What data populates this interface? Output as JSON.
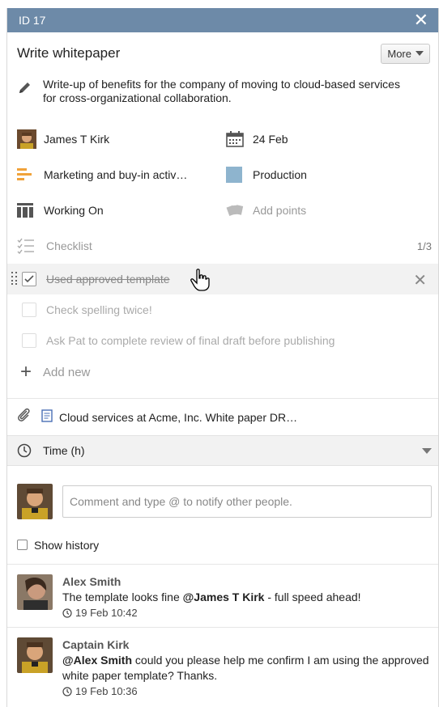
{
  "header": {
    "id_label": "ID 17",
    "close_label": "✕"
  },
  "card": {
    "title": "Write whitepaper",
    "more_label": "More"
  },
  "description": "Write-up of benefits for the company of moving to cloud-based services for cross-organizational collaboration.",
  "properties": {
    "assignee": "James T Kirk",
    "due_date": "24 Feb",
    "lane": "Marketing and buy-in activ…",
    "board": "Production",
    "status": "Working On",
    "points_placeholder": "Add points",
    "colors": {
      "lane_orange": "#f0a23a",
      "board_blue": "#8eb4ce"
    }
  },
  "checklist": {
    "title": "Checklist",
    "count": "1/3",
    "items": [
      {
        "text": "Used approved template",
        "done": true
      },
      {
        "text": "Check spelling twice!",
        "done": false
      },
      {
        "text": "Ask Pat to complete review of final draft before publishing",
        "done": false
      }
    ],
    "add_new_label": "Add new"
  },
  "attachment": {
    "name": "Cloud services at Acme, Inc. White paper DR…"
  },
  "time": {
    "label": "Time (h)"
  },
  "comment": {
    "placeholder": "Comment and type @ to notify other people."
  },
  "history": {
    "label": "Show history"
  },
  "comments": [
    {
      "author": "Alex Smith",
      "mention": "@James T Kirk",
      "after_mention": " - full speed ahead!",
      "before_mention": "The template looks fine ",
      "timestamp": "19 Feb 10:42"
    },
    {
      "author": "Captain Kirk",
      "mention": "@Alex Smith",
      "before_mention": "",
      "after_mention": " could you please help me confirm I am using the approved white paper template? Thanks.",
      "timestamp": "19 Feb 10:36"
    }
  ],
  "theme": {
    "topbar": "#6d8aa8"
  }
}
